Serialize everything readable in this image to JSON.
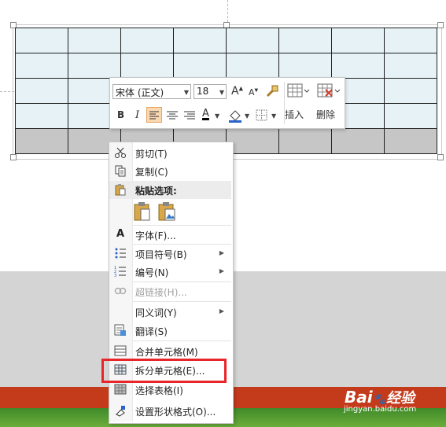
{
  "mini_toolbar": {
    "font_name": "宋体 (正文)",
    "font_size": "18",
    "grow_font": "A",
    "shrink_font": "A",
    "bold": "B",
    "italic": "I",
    "font_color_letter": "A",
    "insert_label": "插入",
    "delete_label": "删除"
  },
  "context_menu": {
    "items": [
      {
        "label": "剪切(T)",
        "icon": "scissors-icon",
        "disabled": false,
        "submenu": false
      },
      {
        "label": "复制(C)",
        "icon": "copy-icon",
        "disabled": false,
        "submenu": false
      },
      {
        "label": "粘贴选项:",
        "icon": "clipboard-icon",
        "disabled": false,
        "submenu": false
      },
      {
        "label": "字体(F)...",
        "icon": "font-icon",
        "disabled": false,
        "submenu": false
      },
      {
        "label": "项目符号(B)",
        "icon": "bullets-icon",
        "disabled": false,
        "submenu": true
      },
      {
        "label": "编号(N)",
        "icon": "numbering-icon",
        "disabled": false,
        "submenu": true
      },
      {
        "label": "超链接(H)...",
        "icon": "hyperlink-icon",
        "disabled": true,
        "submenu": false
      },
      {
        "label": "同义词(Y)",
        "icon": "",
        "disabled": false,
        "submenu": true
      },
      {
        "label": "翻译(S)",
        "icon": "translate-icon",
        "disabled": false,
        "submenu": false
      },
      {
        "label": "合并单元格(M)",
        "icon": "merge-cells-icon",
        "disabled": false,
        "submenu": false
      },
      {
        "label": "拆分单元格(E)...",
        "icon": "split-cells-icon",
        "disabled": false,
        "submenu": false
      },
      {
        "label": "选择表格(I)",
        "icon": "select-table-icon",
        "disabled": false,
        "submenu": false
      },
      {
        "label": "设置形状格式(O)...",
        "icon": "format-shape-icon",
        "disabled": false,
        "submenu": false
      }
    ]
  },
  "highlight_color": "#e8262a",
  "watermark": {
    "brand": "Bai",
    "brand2": "经验",
    "url": "jingyan.baidu.com"
  }
}
